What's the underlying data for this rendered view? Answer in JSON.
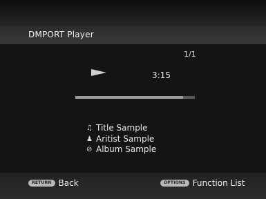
{
  "header": {
    "title": "DMPORT Player"
  },
  "player": {
    "track_counter": "1/1",
    "elapsed_time": "3:15",
    "progress": 0.9,
    "state_icon": "play-icon"
  },
  "metadata": {
    "title": {
      "icon": "music-note-icon",
      "glyph": "♫",
      "label": "Title Sample"
    },
    "artist": {
      "icon": "person-icon",
      "glyph": "♟",
      "label": "Aritist Sample"
    },
    "album": {
      "icon": "disc-icon",
      "glyph": "⊘",
      "label": "Album Sample"
    }
  },
  "footer": {
    "return_key": "RETURN",
    "return_label": "Back",
    "options_key": "OPTIONS",
    "options_label": "Function List"
  },
  "colors": {
    "background": "#141414",
    "text": "#e8e8e8",
    "progress_fill": "#9a9a9a",
    "progress_track": "#5a5a5a"
  }
}
